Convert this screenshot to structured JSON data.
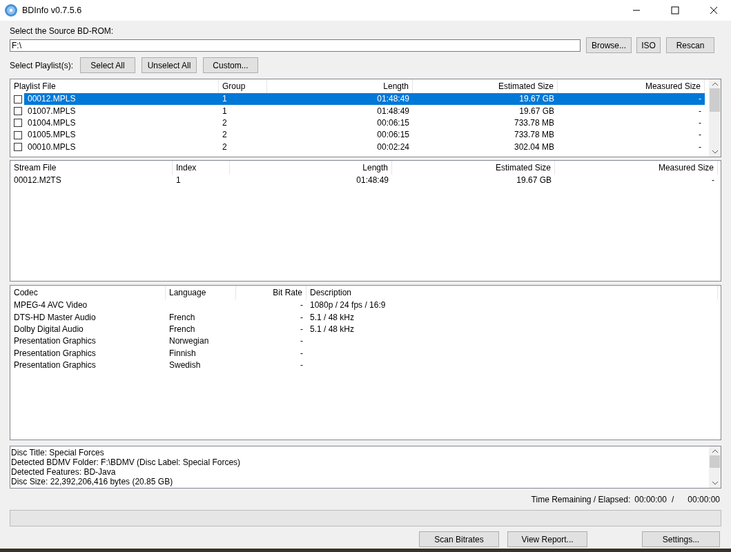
{
  "window": {
    "title": "BDInfo v0.7.5.6"
  },
  "source": {
    "label": "Select the Source BD-ROM:",
    "value": "F:\\",
    "buttons": [
      "Browse...",
      "ISO",
      "Rescan"
    ]
  },
  "playlist_select": {
    "label": "Select Playlist(s):",
    "buttons": [
      "Select All",
      "Unselect All",
      "Custom..."
    ]
  },
  "playlists": {
    "columns": [
      "Playlist File",
      "Group",
      "Length",
      "Estimated Size",
      "Measured Size"
    ],
    "rows": [
      {
        "cells": [
          "00012.MPLS",
          "1",
          "01:48:49",
          "19.67 GB",
          "-"
        ],
        "checked": false,
        "selected": true
      },
      {
        "cells": [
          "01007.MPLS",
          "1",
          "01:48:49",
          "19.67 GB",
          "-"
        ],
        "checked": false,
        "selected": false
      },
      {
        "cells": [
          "01004.MPLS",
          "2",
          "00:06:15",
          "733.78 MB",
          "-"
        ],
        "checked": false,
        "selected": false
      },
      {
        "cells": [
          "01005.MPLS",
          "2",
          "00:06:15",
          "733.78 MB",
          "-"
        ],
        "checked": false,
        "selected": false
      },
      {
        "cells": [
          "00010.MPLS",
          "2",
          "00:02:24",
          "302.04 MB",
          "-"
        ],
        "checked": false,
        "selected": false
      }
    ]
  },
  "streams": {
    "columns": [
      "Stream File",
      "Index",
      "Length",
      "Estimated Size",
      "Measured Size"
    ],
    "rows": [
      {
        "cells": [
          "00012.M2TS",
          "1",
          "01:48:49",
          "19.67 GB",
          "-"
        ]
      }
    ]
  },
  "codecs": {
    "columns": [
      "Codec",
      "Language",
      "Bit Rate",
      "Description"
    ],
    "rows": [
      {
        "cells": [
          "MPEG-4 AVC Video",
          "",
          "-",
          "1080p / 24 fps / 16:9"
        ]
      },
      {
        "cells": [
          "DTS-HD Master Audio",
          "French",
          "-",
          "5.1 / 48 kHz"
        ]
      },
      {
        "cells": [
          "Dolby Digital Audio",
          "French",
          "-",
          "5.1 / 48 kHz"
        ]
      },
      {
        "cells": [
          "Presentation Graphics",
          "Norwegian",
          "-",
          ""
        ]
      },
      {
        "cells": [
          "Presentation Graphics",
          "Finnish",
          "-",
          ""
        ]
      },
      {
        "cells": [
          "Presentation Graphics",
          "Swedish",
          "-",
          ""
        ]
      }
    ]
  },
  "info_lines": [
    "Disc Title: Special Forces",
    "Detected BDMV Folder: F:\\BDMV (Disc Label: Special Forces)",
    "Detected Features: BD-Java",
    "Disc Size: 22,392,206,416 bytes (20.85 GB)"
  ],
  "time": {
    "label": "Time Remaining / Elapsed:",
    "remaining": "00:00:00",
    "separator": "/",
    "elapsed": "00:00:00"
  },
  "progress": {
    "level": 0
  },
  "bottom_buttons": [
    "Scan Bitrates",
    "View Report...",
    "Settings..."
  ]
}
